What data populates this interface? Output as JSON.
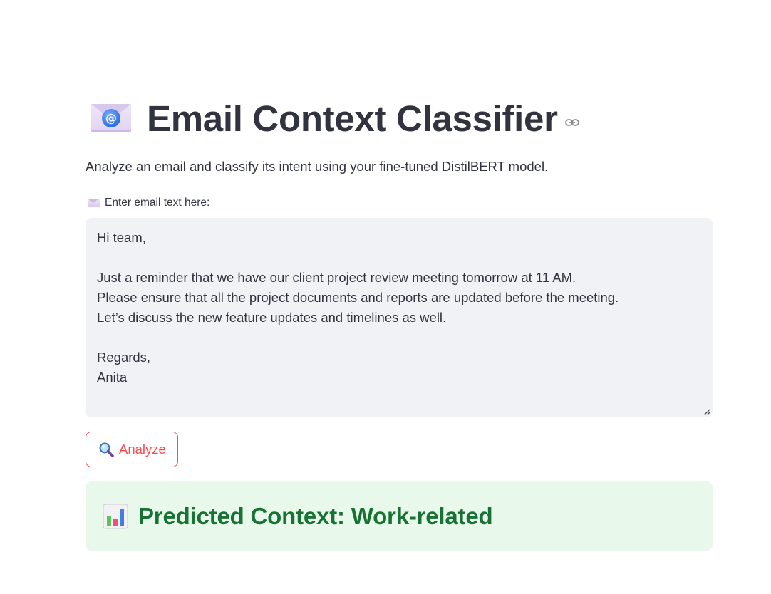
{
  "header": {
    "title": "Email Context Classifier",
    "title_icon": "envelope-with-at-icon",
    "anchor_icon": "link-icon"
  },
  "subtitle": "Analyze an email and classify its intent using your fine-tuned DistilBERT model.",
  "email_field": {
    "label": "Enter email text here:",
    "label_icon": "envelope-icon",
    "value": "Hi team,\n\nJust a reminder that we have our client project review meeting tomorrow at 11 AM.\nPlease ensure that all the project documents and reports are updated before the meeting.\nLet’s discuss the new feature updates and timelines as well.\n\nRegards,\nAnita"
  },
  "analyze_button": {
    "label": "Analyze",
    "icon": "magnifier-icon",
    "accent": "#ff4b4b"
  },
  "result": {
    "text": "Predicted Context: Work-related",
    "icon": "bar-chart-icon",
    "background": "#e8f8ea",
    "color": "#177233"
  }
}
